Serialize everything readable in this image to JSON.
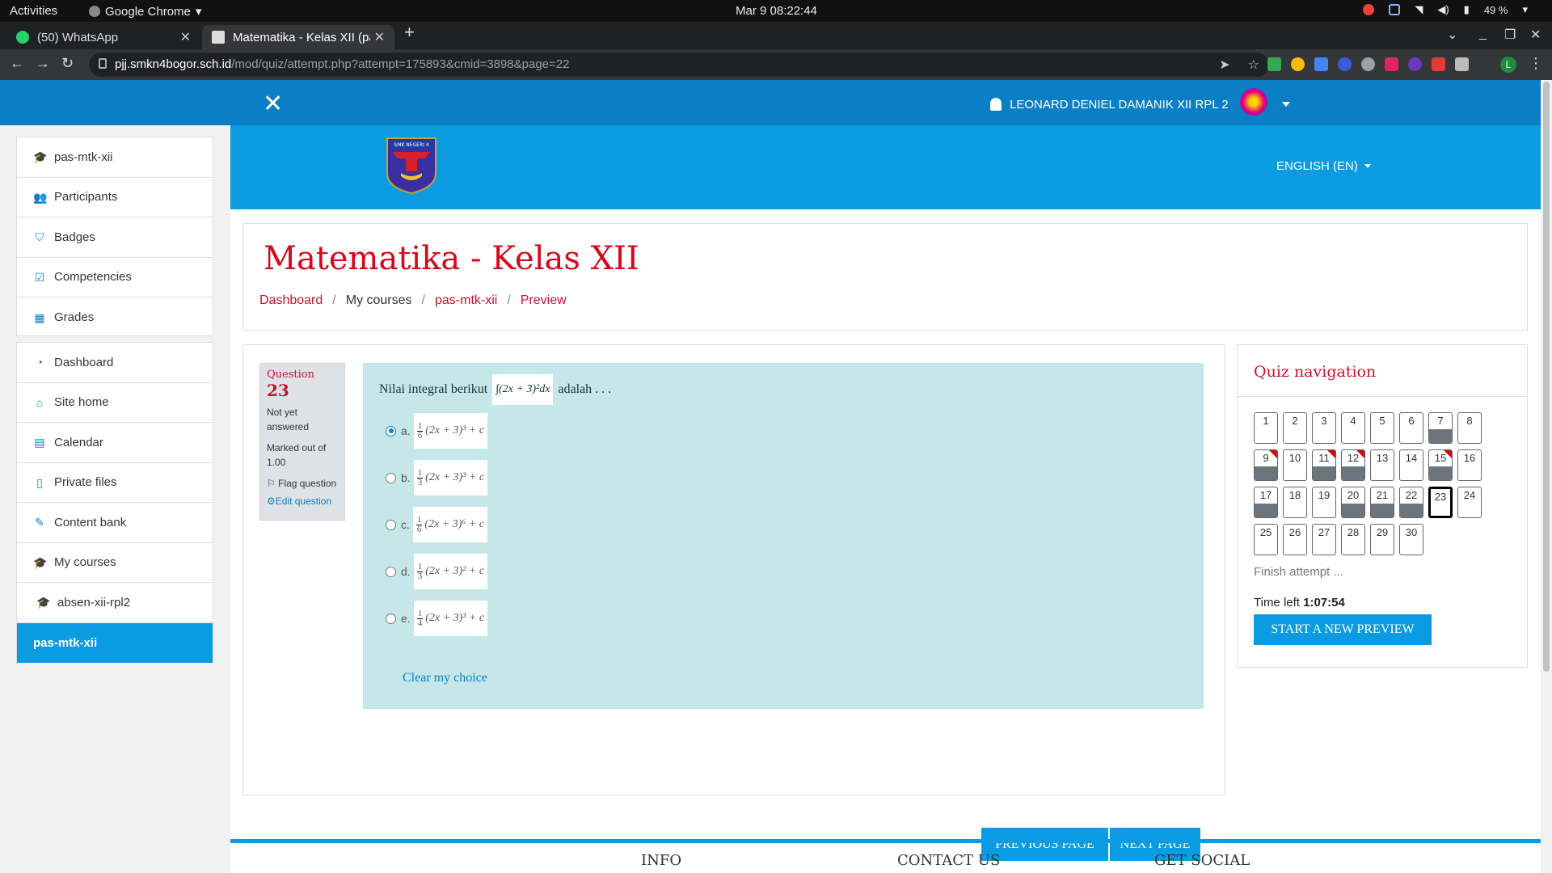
{
  "gnome": {
    "activities": "Activities",
    "app_name": "Google Chrome",
    "clock": "Mar 9  08:22:44",
    "battery": "49 %"
  },
  "tabs": [
    {
      "title": "(50) WhatsApp"
    },
    {
      "title": "Matematika - Kelas XII (pa"
    }
  ],
  "address": {
    "host": "pjj.smkn4bogor.sch.id",
    "path": "/mod/quiz/attempt.php?attempt=175893&cmid=3898&page=22"
  },
  "profile_initial": "L",
  "navbar": {
    "user_name": "LEONARD DENIEL DAMANIK XII RPL 2"
  },
  "drawer": {
    "group1": [
      {
        "label": "pas-mtk-xii",
        "icon": "graduation-cap-icon"
      },
      {
        "label": "Participants",
        "icon": "users-icon"
      },
      {
        "label": "Badges",
        "icon": "shield-icon"
      },
      {
        "label": "Competencies",
        "icon": "check-square-icon"
      },
      {
        "label": "Grades",
        "icon": "table-icon"
      }
    ],
    "group2": [
      {
        "label": "Dashboard",
        "icon": "tachometer-icon"
      },
      {
        "label": "Site home",
        "icon": "home-icon"
      },
      {
        "label": "Calendar",
        "icon": "calendar-icon"
      },
      {
        "label": "Private files",
        "icon": "file-icon"
      },
      {
        "label": "Content bank",
        "icon": "paint-brush-icon"
      },
      {
        "label": "My courses",
        "icon": "graduation-cap-icon"
      },
      {
        "label": "absen-xii-rpl2",
        "icon": "graduation-cap-icon"
      },
      {
        "label": "pas-mtk-xii",
        "icon": "",
        "active": true
      }
    ]
  },
  "header": {
    "language": "ENGLISH (EN)",
    "logo_text": "SMK NEGERI 4"
  },
  "course": {
    "title": "Matematika - Kelas XII",
    "breadcrumb": [
      "Dashboard",
      "My courses",
      "pas-mtk-xii",
      "Preview"
    ]
  },
  "question": {
    "label": "Question",
    "number": "23",
    "state": "Not yet answered",
    "grade": "Marked out of 1.00",
    "flag": "Flag question",
    "edit": "Edit question",
    "text_before": "Nilai integral berikut",
    "integral": "∫(2x + 3)²dx",
    "text_after": "adalah . . .",
    "options": [
      {
        "letter": "a.",
        "num": "1",
        "den": "6",
        "expr": "(2x + 3)³ + c",
        "checked": true
      },
      {
        "letter": "b.",
        "num": "1",
        "den": "3",
        "expr": "(2x + 3)³ + c",
        "checked": false
      },
      {
        "letter": "c.",
        "num": "1",
        "den": "6",
        "expr": "(2x + 3)⁶ + c",
        "checked": false
      },
      {
        "letter": "d.",
        "num": "1",
        "den": "3",
        "expr": "(2x + 3)² + c",
        "checked": false
      },
      {
        "letter": "e.",
        "num": "1",
        "den": "4",
        "expr": "(2x + 3)³ + c",
        "checked": false
      }
    ],
    "clear": "Clear my choice"
  },
  "buttons": {
    "previous": "PREVIOUS PAGE",
    "next": "NEXT PAGE",
    "new_preview": "START A NEW PREVIEW"
  },
  "quiz_nav": {
    "title": "Quiz navigation",
    "questions": [
      {
        "n": "1",
        "answered": false,
        "flagged": false
      },
      {
        "n": "2",
        "answered": false,
        "flagged": false
      },
      {
        "n": "3",
        "answered": false,
        "flagged": false
      },
      {
        "n": "4",
        "answered": false,
        "flagged": false
      },
      {
        "n": "5",
        "answered": false,
        "flagged": false
      },
      {
        "n": "6",
        "answered": false,
        "flagged": false
      },
      {
        "n": "7",
        "answered": true,
        "flagged": false
      },
      {
        "n": "8",
        "answered": false,
        "flagged": false
      },
      {
        "n": "9",
        "answered": true,
        "flagged": true
      },
      {
        "n": "10",
        "answered": false,
        "flagged": false
      },
      {
        "n": "11",
        "answered": true,
        "flagged": true
      },
      {
        "n": "12",
        "answered": true,
        "flagged": true
      },
      {
        "n": "13",
        "answered": false,
        "flagged": false
      },
      {
        "n": "14",
        "answered": false,
        "flagged": false
      },
      {
        "n": "15",
        "answered": true,
        "flagged": true
      },
      {
        "n": "16",
        "answered": false,
        "flagged": false
      },
      {
        "n": "17",
        "answered": true,
        "flagged": false
      },
      {
        "n": "18",
        "answered": false,
        "flagged": false
      },
      {
        "n": "19",
        "answered": false,
        "flagged": false
      },
      {
        "n": "20",
        "answered": true,
        "flagged": false
      },
      {
        "n": "21",
        "answered": true,
        "flagged": false
      },
      {
        "n": "22",
        "answered": true,
        "flagged": false
      },
      {
        "n": "23",
        "answered": false,
        "flagged": false,
        "current": true
      },
      {
        "n": "24",
        "answered": false,
        "flagged": false
      },
      {
        "n": "25",
        "answered": false,
        "flagged": false
      },
      {
        "n": "26",
        "answered": false,
        "flagged": false
      },
      {
        "n": "27",
        "answered": false,
        "flagged": false
      },
      {
        "n": "28",
        "answered": false,
        "flagged": false
      },
      {
        "n": "29",
        "answered": false,
        "flagged": false
      },
      {
        "n": "30",
        "answered": false,
        "flagged": false
      }
    ],
    "finish": "Finish attempt ...",
    "time_label": "Time left",
    "time_value": "1:07:54"
  },
  "footer": {
    "info": "INFO",
    "contact": "CONTACT US",
    "social": "GET SOCIAL"
  },
  "colors": {
    "brand_blue": "#0b9be3",
    "navbar_blue": "#0b7fc6",
    "accent_red": "#c8102e",
    "question_bg": "#c5e7e9"
  }
}
